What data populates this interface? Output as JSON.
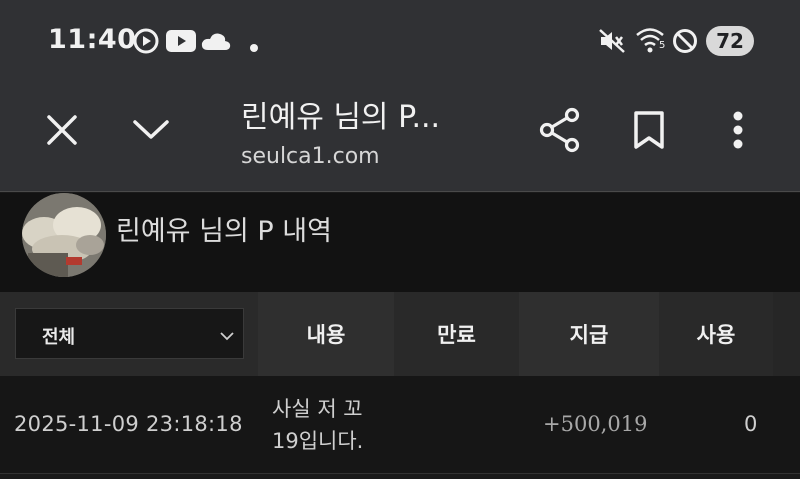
{
  "status_bar": {
    "time": "11:40",
    "icons": [
      "media-play-icon",
      "youtube-icon",
      "cloud-icon",
      "dot-icon",
      "mute-icon",
      "wifi-icon",
      "dnd-icon"
    ],
    "battery": "72"
  },
  "toolbar": {
    "title": "린예유 님의 P...",
    "url": "seulca1.com",
    "buttons": [
      "close-icon",
      "chevron-down-icon",
      "share-icon",
      "bookmark-icon",
      "more-vertical-icon"
    ]
  },
  "profile": {
    "title": "린예유 님의 P 내역"
  },
  "table": {
    "filter_selected": "전체",
    "headers": {
      "content": "내용",
      "expire": "만료",
      "pay": "지급",
      "use": "사용"
    },
    "rows": [
      {
        "date": "2025-11-09 23:18:18",
        "content_line1": "사실 저 꼬",
        "content_line2": "19입니다.",
        "pay": "+500,019",
        "use": "0"
      }
    ]
  },
  "colors": {
    "toolbar_bg": "#303134",
    "profile_bg": "#121212",
    "header_bg": "#262626",
    "row_bg": "#161616"
  }
}
